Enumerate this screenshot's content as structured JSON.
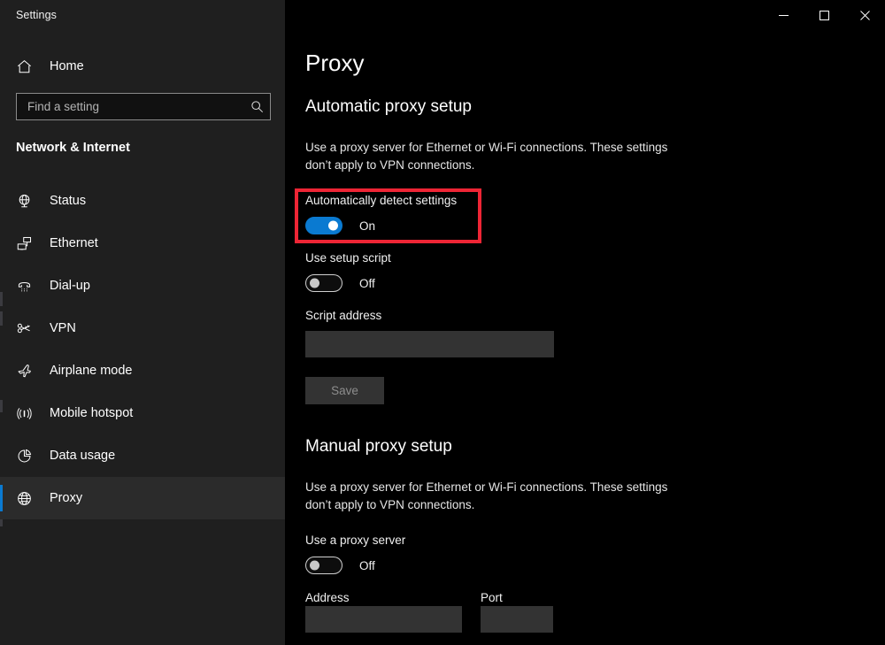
{
  "window": {
    "title": "Settings",
    "controls": [
      {
        "name": "minimize-button",
        "label": "Minimize",
        "glyph": "minimize-icon"
      },
      {
        "name": "maximize-button",
        "label": "Maximize",
        "glyph": "maximize-icon"
      },
      {
        "name": "close-button",
        "label": "Close",
        "glyph": "close-icon"
      }
    ]
  },
  "sidebar": {
    "home": {
      "label": "Home",
      "icon": "home-icon"
    },
    "search": {
      "value": "",
      "placeholder": "Find a setting",
      "icon": "search-icon"
    },
    "category": "Network & Internet",
    "items": [
      {
        "label": "Status",
        "icon": "globe-status-icon",
        "selected": false
      },
      {
        "label": "Ethernet",
        "icon": "ethernet-icon",
        "selected": false
      },
      {
        "label": "Dial-up",
        "icon": "dialup-phone-icon",
        "selected": false
      },
      {
        "label": "VPN",
        "icon": "vpn-key-icon",
        "selected": false
      },
      {
        "label": "Airplane mode",
        "icon": "airplane-icon",
        "selected": false
      },
      {
        "label": "Mobile hotspot",
        "icon": "hotspot-signal-icon",
        "selected": false
      },
      {
        "label": "Data usage",
        "icon": "pie-chart-icon",
        "selected": false
      },
      {
        "label": "Proxy",
        "icon": "globe-icon",
        "selected": true
      }
    ]
  },
  "main": {
    "page_title": "Proxy",
    "automatic": {
      "heading": "Automatic proxy setup",
      "description": "Use a proxy server for Ethernet or Wi-Fi connections. These settings don’t apply to VPN connections.",
      "auto_detect": {
        "label": "Automatically detect settings",
        "state": "On",
        "on": true,
        "highlighted": true
      },
      "setup_script": {
        "label": "Use setup script",
        "state": "Off",
        "on": false
      },
      "script_address": {
        "label": "Script address",
        "value": "",
        "placeholder": ""
      },
      "save_button": {
        "label": "Save",
        "disabled": true
      }
    },
    "manual": {
      "heading": "Manual proxy setup",
      "description": "Use a proxy server for Ethernet or Wi-Fi connections. These settings don’t apply to VPN connections.",
      "use_proxy": {
        "label": "Use a proxy server",
        "state": "Off",
        "on": false
      },
      "address": {
        "label": "Address",
        "value": "",
        "placeholder": ""
      },
      "port": {
        "label": "Port",
        "value": "",
        "placeholder": ""
      }
    }
  },
  "colors": {
    "accent_blue": "#0a7ad1",
    "sidebar_bg": "#1f1f1f",
    "content_bg": "#000000",
    "input_bg": "#333333",
    "highlight_red": "#ee2535",
    "text_primary": "#ffffff",
    "text_disabled": "#8d8d8d"
  }
}
